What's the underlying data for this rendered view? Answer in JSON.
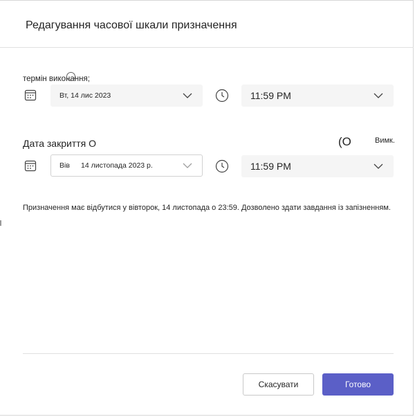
{
  "dialog": {
    "title": "Редагування часової шкали призначення"
  },
  "due": {
    "label": "термін виконання;",
    "date_value": "Вт, 14 лис 2023",
    "time_value": "11:59 PM"
  },
  "close": {
    "label": "Дата закриття О",
    "toggle_glyph": "(О",
    "toggle_state": "Вимк.",
    "date_day": "Вів",
    "date_value": "14 листопада 2023 р.",
    "time_value": "11:59 PM"
  },
  "note": "Призначення має відбутися у вівторок, 14 листопада о 23:59. Дозволено здати завдання із запізненням.",
  "footer": {
    "cancel_label": "Скасувати",
    "done_label": "Готово"
  },
  "colors": {
    "primary": "#5b5fc7",
    "field_bg": "#f5f5f5",
    "divider": "#e0e0e0"
  }
}
